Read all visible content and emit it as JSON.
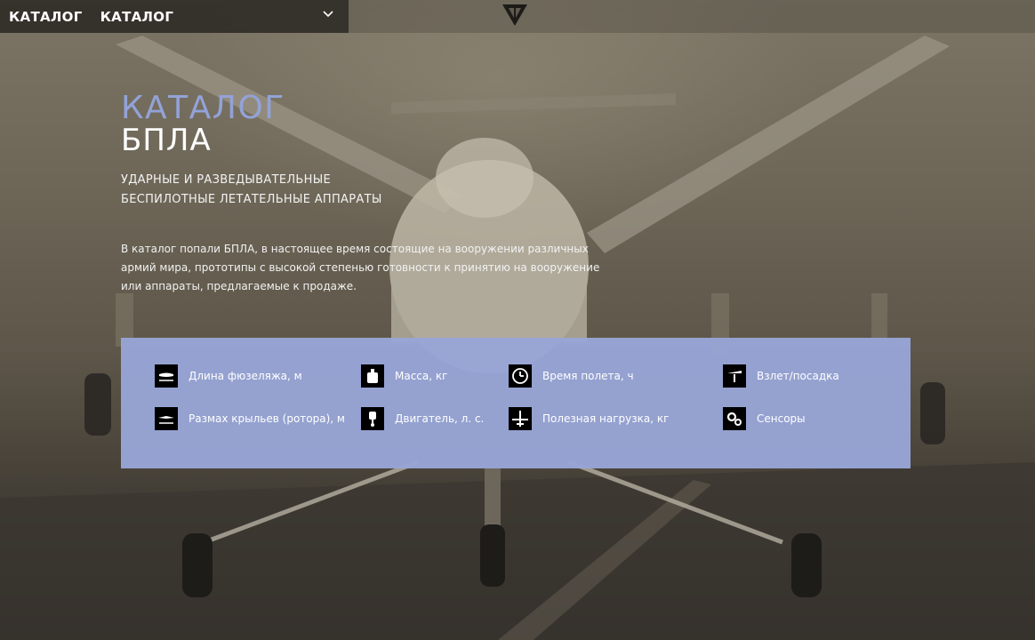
{
  "header": {
    "title_1": "КАТАЛОГ",
    "title_2": "КАТАЛОГ",
    "dropdown_icon": "chevron-down-icon",
    "logo_icon": "triangle-logo-icon"
  },
  "hero": {
    "title_line1": "КАТАЛОГ",
    "title_line2": "БПЛА",
    "subtitle_line1": "УДАРНЫЕ И РАЗВЕДЫВАТЕЛЬНЫЕ",
    "subtitle_line2": "БЕСПИЛОТНЫЕ ЛЕТАТЕЛЬНЫЕ АППАРАТЫ",
    "desc_line1": "В каталог попали БПЛА, в настоящее время состоящие на вооружении различных",
    "desc_line2": "армий мира, прототипы с высокой степенью готовности к принятию на вооружение",
    "desc_line3": "или аппараты, предлагаемые к продаже."
  },
  "legend": {
    "items": [
      {
        "label": "Длина фюзеляжа, м",
        "icon": "fuselage-length-icon"
      },
      {
        "label": "Масса, кг",
        "icon": "weight-icon"
      },
      {
        "label": "Время полета, ч",
        "icon": "clock-icon"
      },
      {
        "label": "Взлет/посадка",
        "icon": "takeoff-landing-icon"
      },
      {
        "label": "Размах крыльев (ротора), м",
        "icon": "wingspan-icon"
      },
      {
        "label": "Двигатель, л. с.",
        "icon": "engine-icon"
      },
      {
        "label": "Полезная нагрузка, кг",
        "icon": "payload-icon"
      },
      {
        "label": "Сенсоры",
        "icon": "sensors-icon"
      }
    ]
  },
  "colors": {
    "accent": "#93a2d8",
    "panel": "#98a5d6",
    "nav_bg": "#2d2a26"
  }
}
